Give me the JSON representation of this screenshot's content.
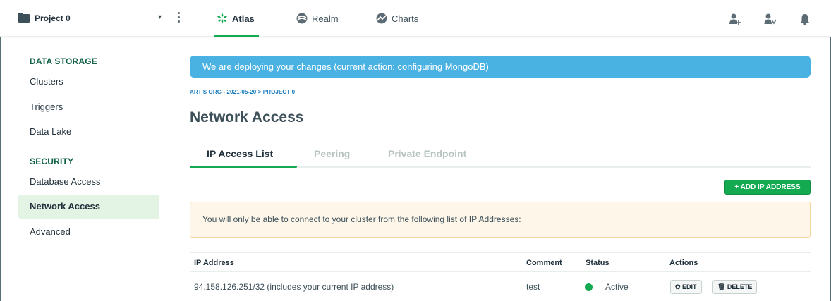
{
  "topbar": {
    "project_name": "Project 0",
    "caret": "▾",
    "tabs": [
      {
        "label": "Atlas",
        "icon": "atlas-leaf-icon",
        "active": true
      },
      {
        "label": "Realm",
        "icon": "realm-icon",
        "active": false
      },
      {
        "label": "Charts",
        "icon": "charts-icon",
        "active": false
      }
    ],
    "right_icons": [
      "invite-user-icon",
      "activity-feed-icon",
      "bell-icon"
    ]
  },
  "sidebar": {
    "sections": [
      {
        "heading": "DATA STORAGE",
        "items": [
          "Clusters",
          "Triggers",
          "Data Lake"
        ]
      },
      {
        "heading": "SECURITY",
        "items": [
          "Database Access",
          "Network Access",
          "Advanced"
        ]
      }
    ],
    "active_item": "Network Access"
  },
  "main": {
    "banner": "We are deploying your changes (current action: configuring MongoDB)",
    "breadcrumb": "ART'S ORG - 2021-05-20 > PROJECT 0",
    "title": "Network Access",
    "tabs": [
      "IP Access List",
      "Peering",
      "Private Endpoint"
    ],
    "active_tab": "IP Access List",
    "add_button": "+ ADD IP ADDRESS",
    "notice": "You will only be able to connect to your cluster from the following list of IP Addresses:",
    "table": {
      "columns": [
        "IP Address",
        "Comment",
        "Status",
        "Actions"
      ],
      "rows": [
        {
          "ip": "94.158.126.251/32  (includes your current IP address)",
          "comment": "test",
          "status": "Active",
          "edit": "✿ EDIT",
          "delete": "🗑 DELETE"
        }
      ]
    }
  },
  "colors": {
    "accent": "#13aa52",
    "banner": "#4ab1e3",
    "link": "#1a7dbf"
  }
}
